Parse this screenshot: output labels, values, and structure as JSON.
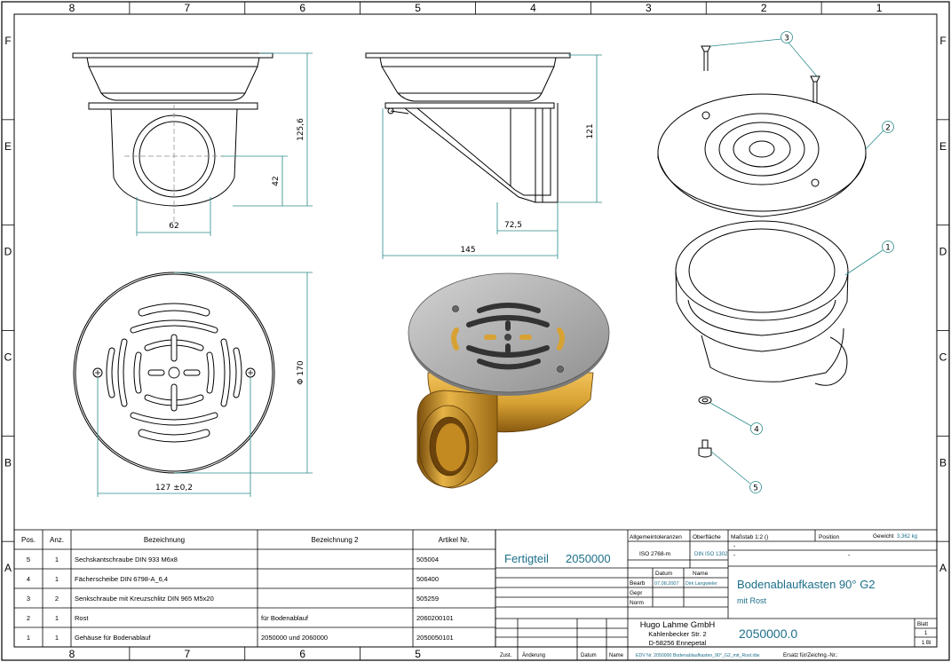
{
  "frame": {
    "columns": [
      "8",
      "7",
      "6",
      "5",
      "4",
      "3",
      "2",
      "1"
    ],
    "bottom_columns": [
      "8",
      "7",
      "6",
      "5"
    ],
    "rows": [
      "F",
      "E",
      "D",
      "C",
      "B",
      "A"
    ]
  },
  "dimensions": {
    "front_width": "62",
    "front_height": "125,6",
    "front_center": "42",
    "side_height": "121",
    "side_offset": "72,5",
    "side_width": "145",
    "plan_diameter": "Φ 170",
    "plan_holes": "127 ±0,2"
  },
  "balloons": [
    "3",
    "2",
    "1",
    "4",
    "5"
  ],
  "parts_list": {
    "headers": [
      "Pos.",
      "Anz.",
      "Bezeichnung",
      "Bezeichnung 2",
      "Artikel Nr."
    ],
    "rows": [
      [
        "5",
        "1",
        "Sechskantschraube DIN 933 M6x8",
        "",
        "505004"
      ],
      [
        "4",
        "1",
        "Fächerscheibe DIN 6798-A_6,4",
        "",
        "506400"
      ],
      [
        "3",
        "2",
        "Senkschraube mit Kreuzschlitz DIN 965 M5x20",
        "",
        "505259"
      ],
      [
        "2",
        "1",
        "Rost",
        "für Bodenablauf",
        "2060200101"
      ],
      [
        "1",
        "1",
        "Gehäuse für Bodenablauf",
        "2050000 und 2060000",
        "2050050101"
      ]
    ]
  },
  "title_block": {
    "fertigteil_label": "Fertigteil",
    "fertigteil_number": "2050000",
    "allg_toleranzen": "Allgemeintoleranzen",
    "allg_value": "ISO 2768-m",
    "oberflaeche": "Oberfläche",
    "oberflaeche_value": "DIN ISO 1302",
    "massstab": "Maßstab  1:2 ()",
    "position": "Position",
    "gewicht": "Gewicht",
    "gewicht_value": "3,362 kg",
    "dash1": "-",
    "dash2": "-",
    "dash3": "-",
    "datum": "Datum",
    "name": "Name",
    "bearb": "Bearb",
    "bearb_date": "07.08.2007",
    "bearb_name": "Dirk Langwieler",
    "gepr": "Gepr",
    "norm": "Norm",
    "title": "Bodenablaufkasten 90° G2",
    "subtitle": "mit Rost",
    "company": "Hugo Lahme GmbH",
    "street": "Kahlenbecker Str. 2",
    "city": "D-58256 Ennepetal",
    "drawing_number": "2050000.0",
    "blatt": "Blatt",
    "blatt_value": "1",
    "blatt_of": "1  Bl",
    "zust": "Zust.",
    "aenderung": "Änderung",
    "datum2": "Datum",
    "name2": "Name",
    "edv": "EDV Nr. 2050000 Bodenablaufkasten_90°_G2_mit_Rost.idw",
    "ersatz": "Ersatz für/Zeichng.-Nr.:"
  },
  "colors": {
    "brass": "#d8a233",
    "brass_dark": "#8a5a10",
    "steel": "#a9a9a9",
    "dim_line": "#2b8a8a",
    "blue_text": "#1d6f8a"
  }
}
